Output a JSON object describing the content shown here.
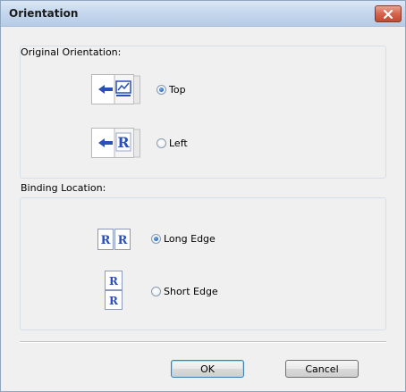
{
  "window": {
    "title": "Orientation"
  },
  "original_orientation": {
    "label": "Original Orientation:",
    "options": [
      {
        "label": "Top",
        "selected": true,
        "icon": "arrow-chart-page-icon"
      },
      {
        "label": "Left",
        "selected": false,
        "icon": "arrow-r-page-icon"
      }
    ]
  },
  "binding_location": {
    "label": "Binding Location:",
    "options": [
      {
        "label": "Long Edge",
        "selected": true,
        "icon": "two-pages-side-by-side-icon"
      },
      {
        "label": "Short Edge",
        "selected": false,
        "icon": "two-pages-stacked-icon"
      }
    ]
  },
  "buttons": {
    "ok": "OK",
    "cancel": "Cancel"
  },
  "colors": {
    "title_bar": "#c6d8ee",
    "close_button": "#d6644c",
    "radio_selected": "#2a66b8",
    "icon_blue": "#2a4fb8"
  }
}
